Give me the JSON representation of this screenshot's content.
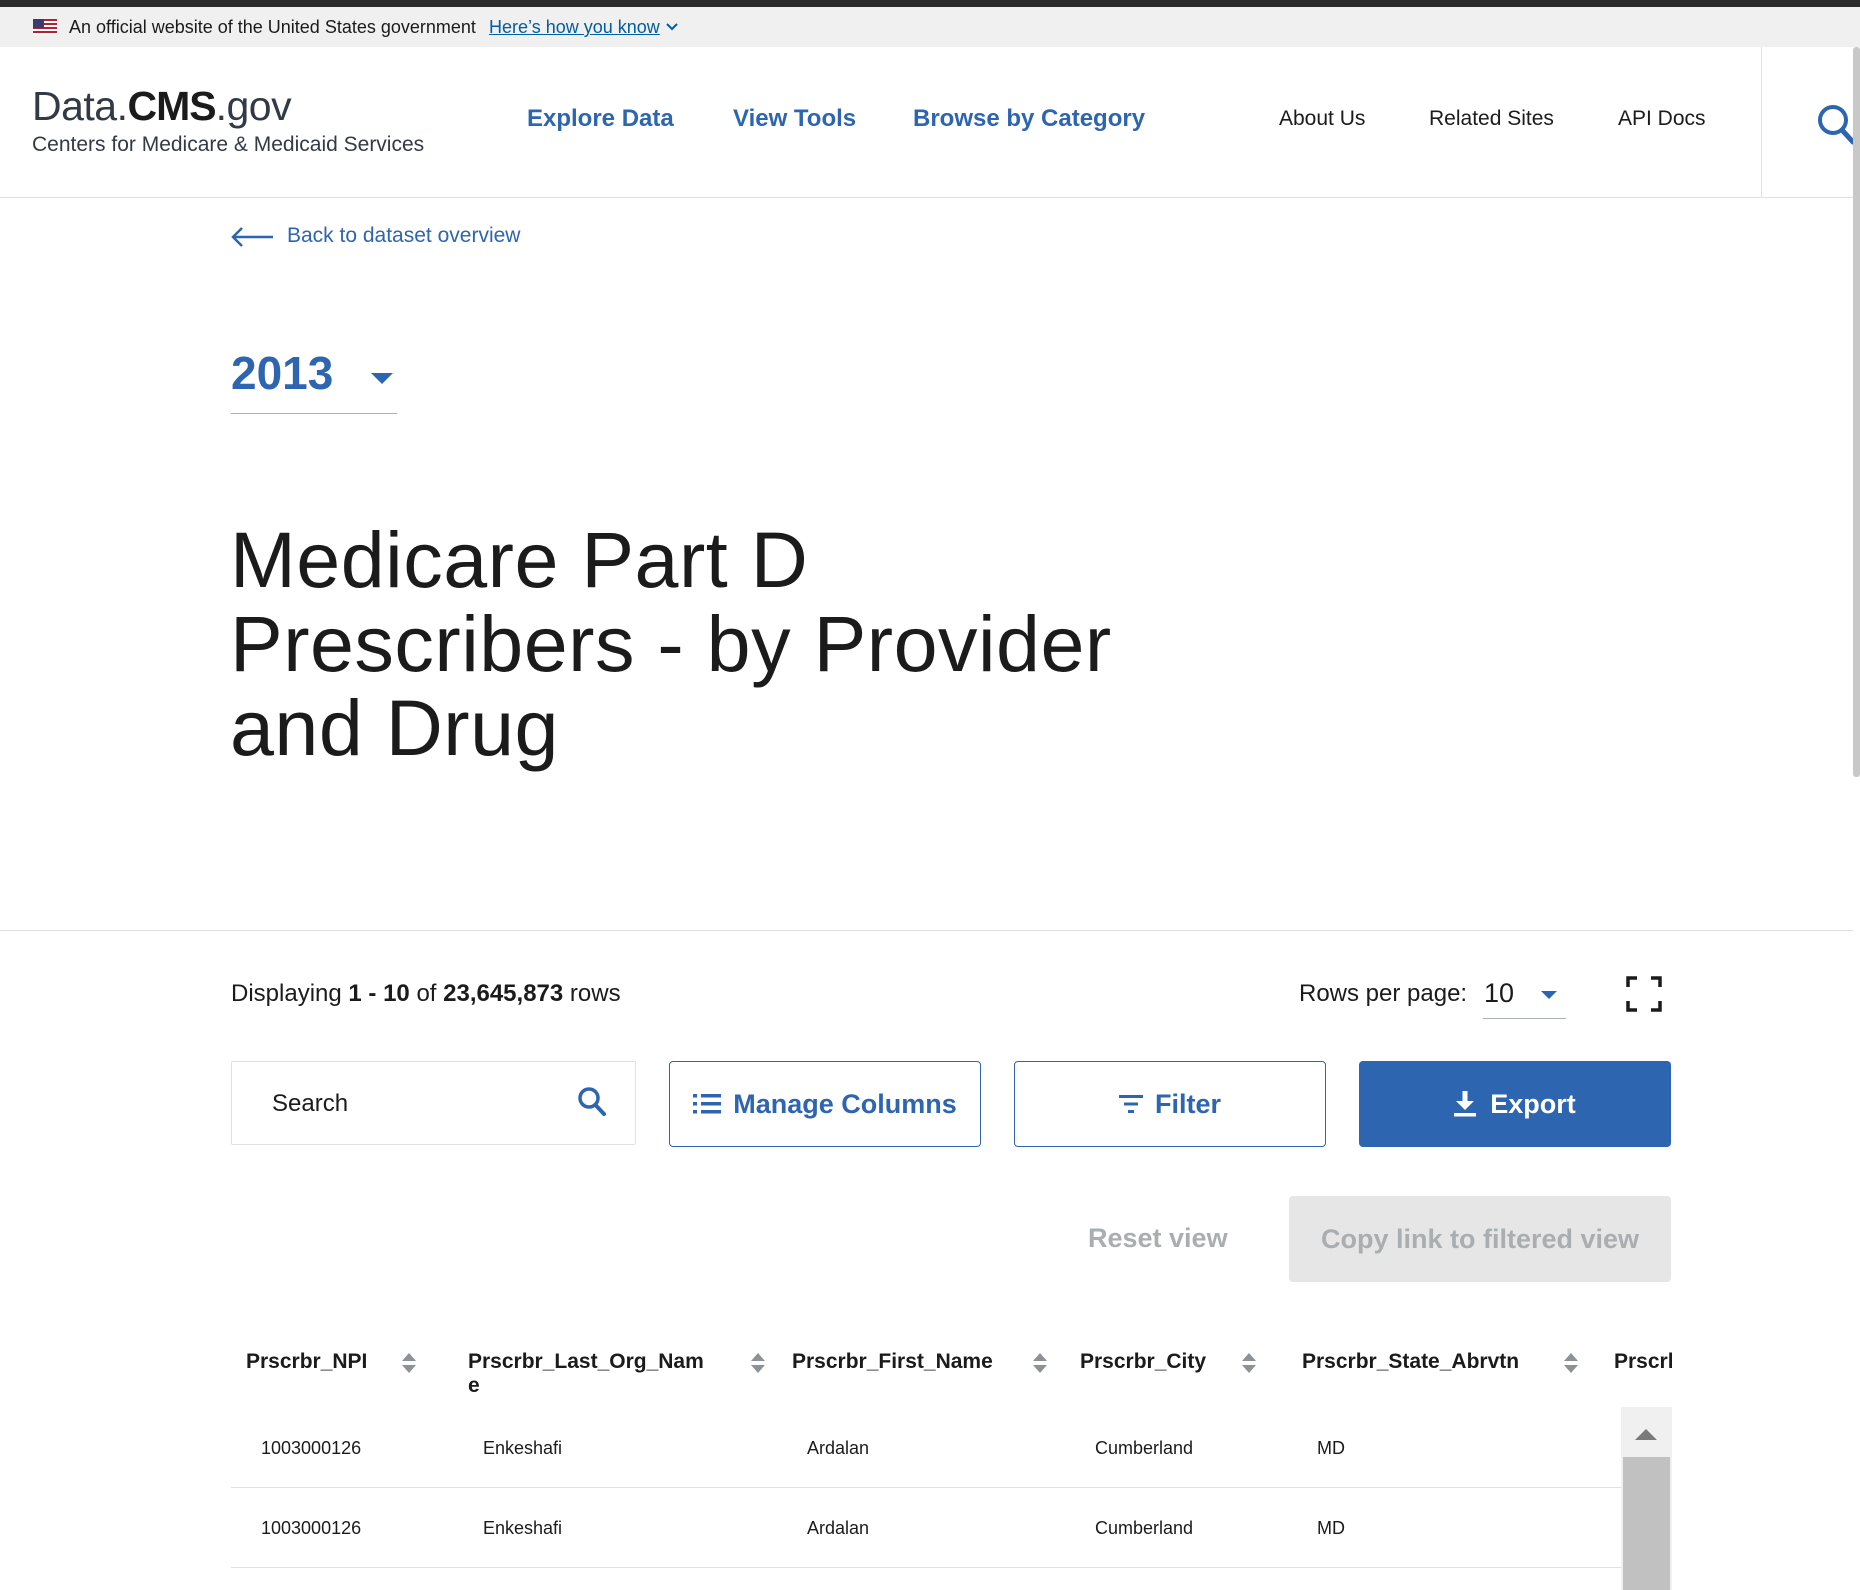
{
  "gov_banner": {
    "text": "An official website of the United States government",
    "link": "Here’s how you know"
  },
  "header": {
    "logo": {
      "part1": "Data.",
      "part2": "CMS",
      "part3": ".gov"
    },
    "tagline": "Centers for Medicare & Medicaid Services",
    "nav_main": [
      "Explore Data",
      "View Tools",
      "Browse by Category"
    ],
    "nav_secondary": [
      "About Us",
      "Related Sites",
      "API Docs"
    ]
  },
  "back_link": "Back to dataset overview",
  "year_select": "2013",
  "title": "Medicare Part D Prescribers - by Provider and Drug",
  "toolbar": {
    "displaying_prefix": "Displaying",
    "range": "1 - 10",
    "of": "of",
    "total": "23,645,873",
    "rows_suffix": "rows",
    "rows_per_page_label": "Rows per page:",
    "rows_per_page_value": "10",
    "search_placeholder": "Search",
    "manage_columns": "Manage Columns",
    "filter": "Filter",
    "export": "Export",
    "reset_view": "Reset view",
    "copy_link": "Copy link to filtered view"
  },
  "table": {
    "headers": [
      "Prscrbr_NPI",
      "Prscrbr_Last_Org_Nam",
      "e",
      "Prscrbr_First_Name",
      "Prscrbr_City",
      "Prscrbr_State_Abrvtn",
      "Prscrl"
    ],
    "rows": [
      [
        "1003000126",
        "Enkeshafi",
        "Ardalan",
        "Cumberland",
        "MD"
      ],
      [
        "1003000126",
        "Enkeshafi",
        "Ardalan",
        "Cumberland",
        "MD"
      ]
    ]
  },
  "colors": {
    "brand_blue": "#2d65b0",
    "link_blue": "#005ea2",
    "disabled_text": "#a9aeb1",
    "disabled_bg": "#e6e6e6"
  },
  "icons": [
    "us-flag-icon",
    "chevron-down-icon",
    "search-icon",
    "arrow-left-icon",
    "caret-down-icon",
    "fullscreen-icon",
    "list-icon",
    "filter-icon",
    "download-icon",
    "sort-icon",
    "scroll-up-icon"
  ]
}
